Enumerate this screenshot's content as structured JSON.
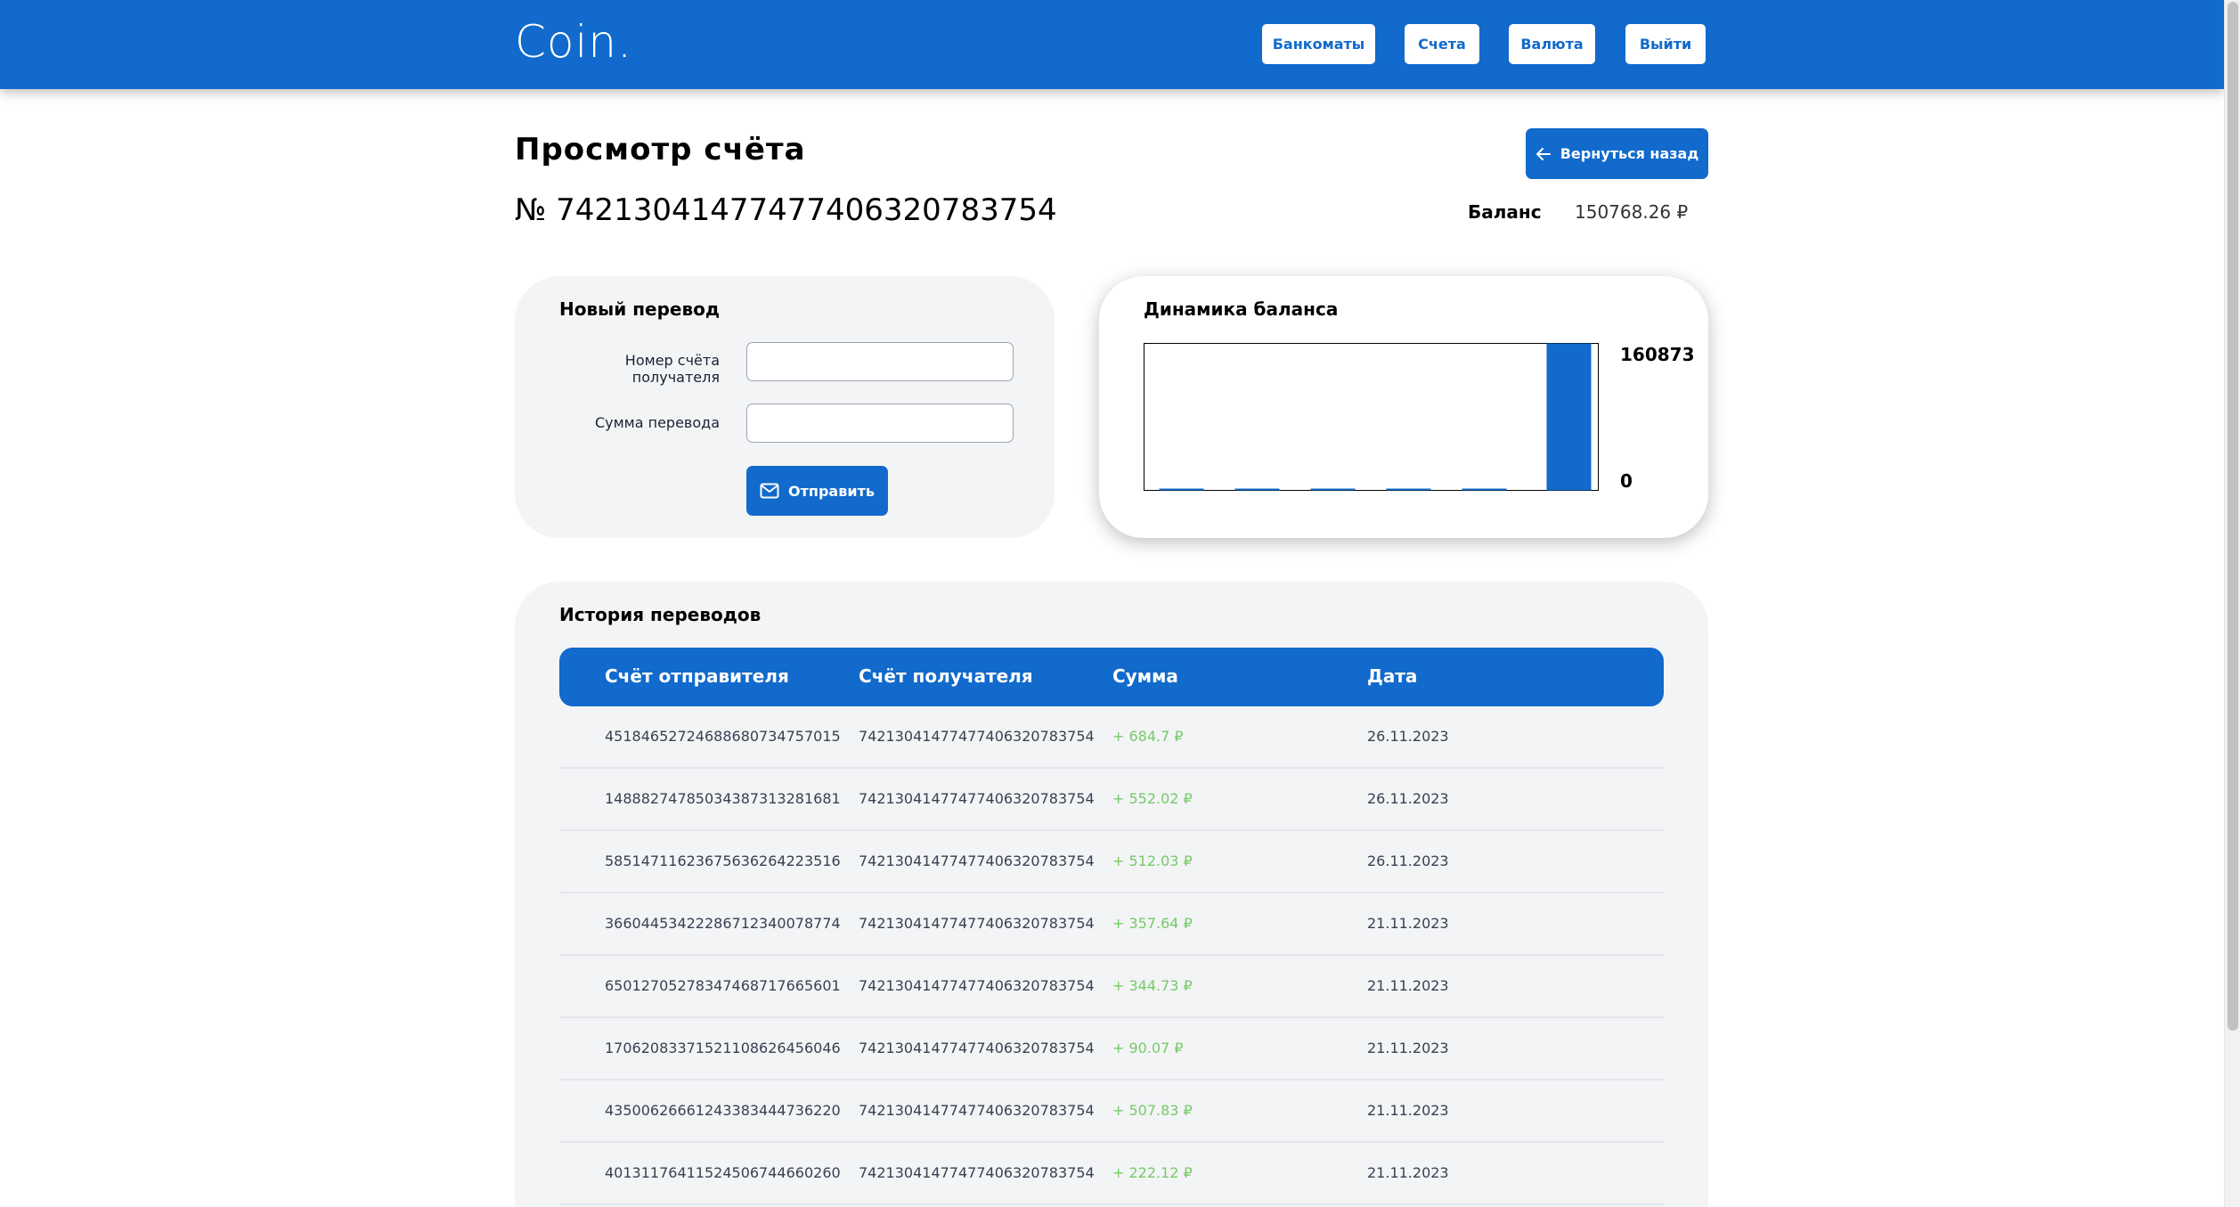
{
  "header": {
    "logo": "Coin.",
    "nav": [
      "Банкоматы",
      "Счета",
      "Валюта",
      "Выйти"
    ]
  },
  "page": {
    "title": "Просмотр счёта",
    "back_label": "Вернуться назад",
    "account_number": "№ 74213041477477406320783754",
    "balance_label": "Баланс",
    "balance_value": "150768.26 ₽"
  },
  "transfer": {
    "title": "Новый перевод",
    "recipient_label": "Номер счёта получателя",
    "amount_label": "Сумма перевода",
    "recipient_value": "",
    "amount_value": "",
    "send_label": "Отправить"
  },
  "chart_data": {
    "type": "bar",
    "title": "Динамика баланса",
    "categories": [
      "",
      "",
      "",
      "",
      "",
      ""
    ],
    "values": [
      0,
      0,
      0,
      0,
      0,
      160873
    ],
    "ylim": [
      0,
      160873
    ],
    "y_max_label": "160873",
    "y_min_label": "0",
    "color": "#116acc"
  },
  "history": {
    "title": "История переводов",
    "columns": [
      "Счёт отправителя",
      "Счёт получателя",
      "Сумма",
      "Дата"
    ],
    "rows": [
      {
        "from": "45184652724688680734757015",
        "to": "74213041477477406320783754",
        "amount": "+ 684.7 ₽",
        "date": "26.11.2023"
      },
      {
        "from": "14888274785034387313281681",
        "to": "74213041477477406320783754",
        "amount": "+ 552.02 ₽",
        "date": "26.11.2023"
      },
      {
        "from": "58514711623675636264223516",
        "to": "74213041477477406320783754",
        "amount": "+ 512.03 ₽",
        "date": "26.11.2023"
      },
      {
        "from": "36604453422286712340078774",
        "to": "74213041477477406320783754",
        "amount": "+ 357.64 ₽",
        "date": "21.11.2023"
      },
      {
        "from": "65012705278347468717665601",
        "to": "74213041477477406320783754",
        "amount": "+ 344.73 ₽",
        "date": "21.11.2023"
      },
      {
        "from": "17062083371521108626456046",
        "to": "74213041477477406320783754",
        "amount": "+ 90.07 ₽",
        "date": "21.11.2023"
      },
      {
        "from": "43500626661243383444736220",
        "to": "74213041477477406320783754",
        "amount": "+ 507.83 ₽",
        "date": "21.11.2023"
      },
      {
        "from": "40131176411524506744660260",
        "to": "74213041477477406320783754",
        "amount": "+ 222.12 ₽",
        "date": "21.11.2023"
      }
    ]
  }
}
